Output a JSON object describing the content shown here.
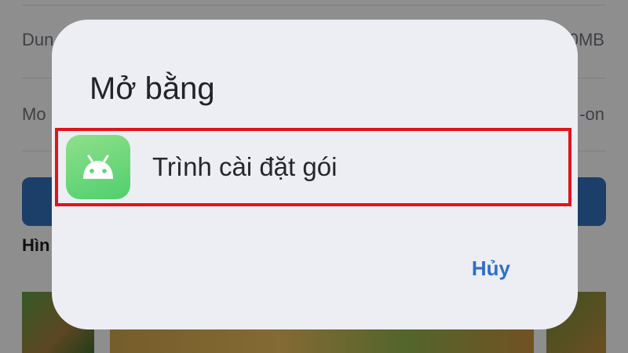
{
  "background": {
    "row1_left": "Dun",
    "row1_right": "0MB",
    "row2_left": "Mo",
    "row2_right": "-on",
    "section_heading": "Hìn"
  },
  "dialog": {
    "title": "Mở bằng",
    "options": [
      {
        "label": "Trình cài đặt gói",
        "icon": "android-icon",
        "highlighted": true
      }
    ],
    "cancel_label": "Hủy"
  },
  "colors": {
    "highlight_border": "#e0141b",
    "cancel_text": "#2f6fc4",
    "app_icon": "#5fd575"
  }
}
